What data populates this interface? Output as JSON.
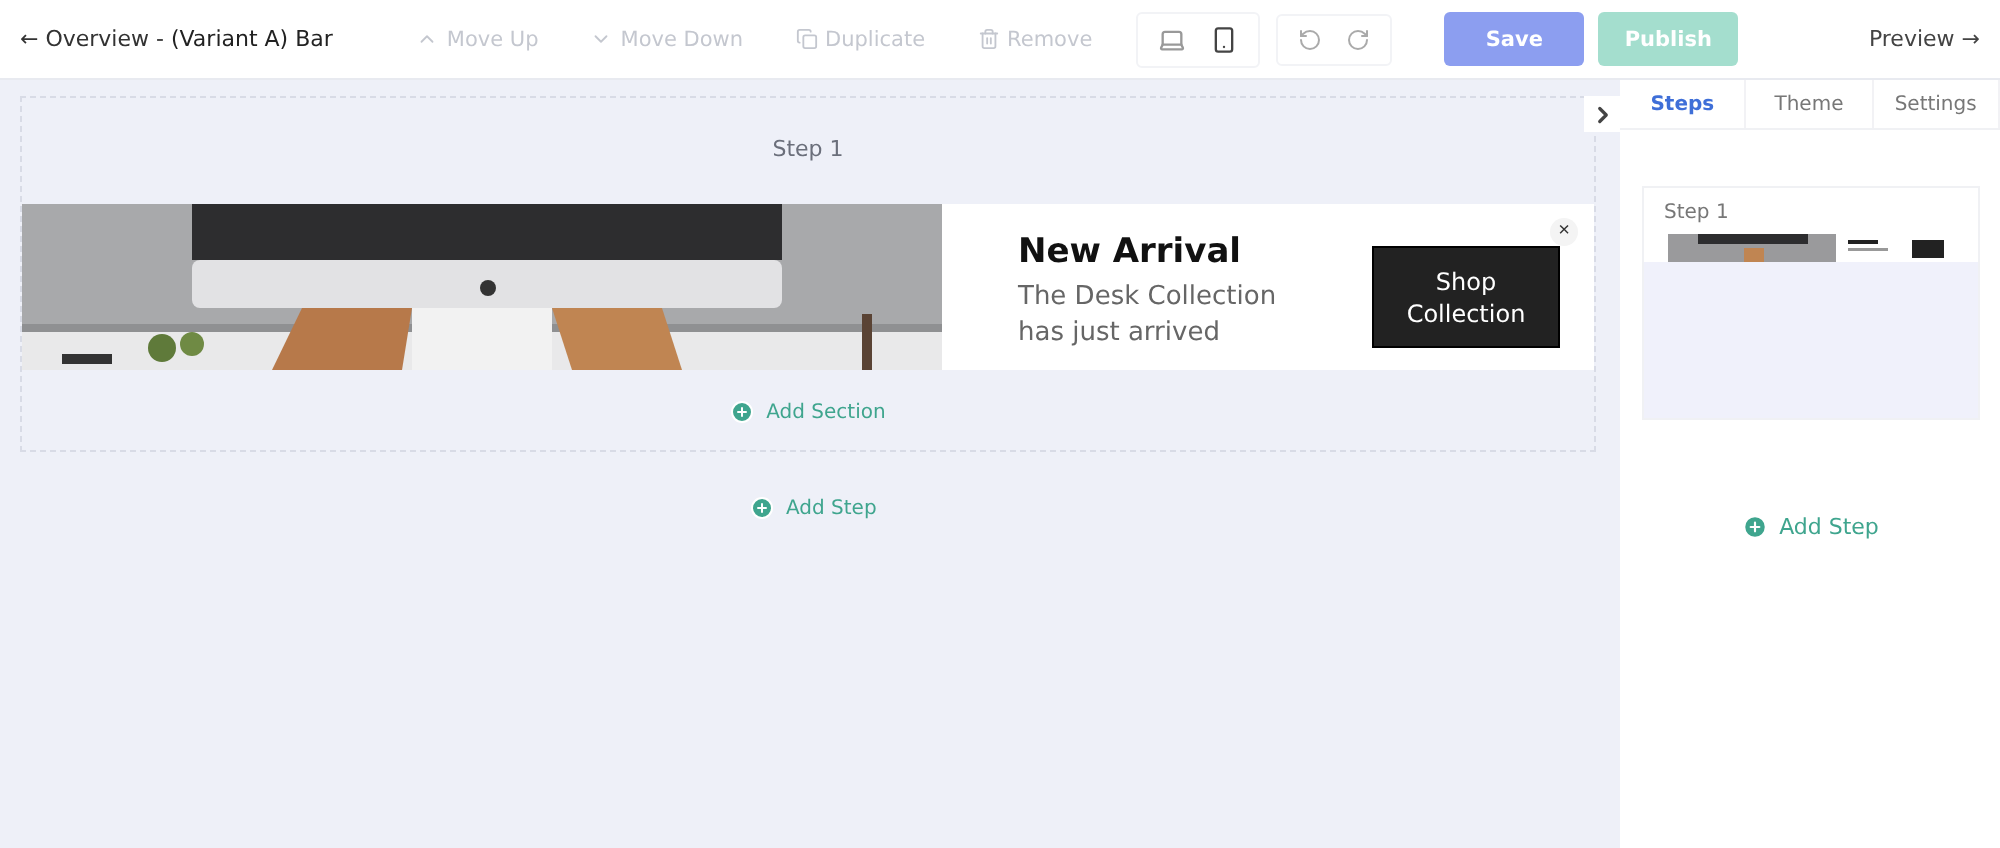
{
  "header": {
    "back": "← Overview - ",
    "title": "(Variant A) Bar",
    "preview": "Preview →"
  },
  "toolbar": [
    {
      "kind": "up",
      "label": "Move Up",
      "disabled": true
    },
    {
      "kind": "down",
      "label": "Move Down",
      "disabled": true
    },
    {
      "kind": "duplicate",
      "label": "Duplicate",
      "disabled": true
    },
    {
      "kind": "remove",
      "label": "Remove",
      "disabled": true
    }
  ],
  "actions": [
    {
      "label": "Save",
      "kind": "save",
      "disabled": false
    },
    {
      "label": "Publish",
      "kind": "publish",
      "disabled": true
    }
  ],
  "canvas": {
    "step_title": "Step 1",
    "banner": {
      "kind": "picture",
      "heading": "New Arrival",
      "text": "The Desk Collection has just arrived",
      "button": "Shop Collection",
      "close": "×"
    },
    "add_section": "Add Section",
    "add_step": "Add Step"
  },
  "sidebar": {
    "tabs": [
      {
        "label": "Steps",
        "selected": true
      },
      {
        "label": "Theme",
        "selected": false
      },
      {
        "label": "Settings",
        "selected": false
      }
    ],
    "steps": [
      {
        "title": "Step 1"
      }
    ],
    "add_step": "Add Step"
  }
}
